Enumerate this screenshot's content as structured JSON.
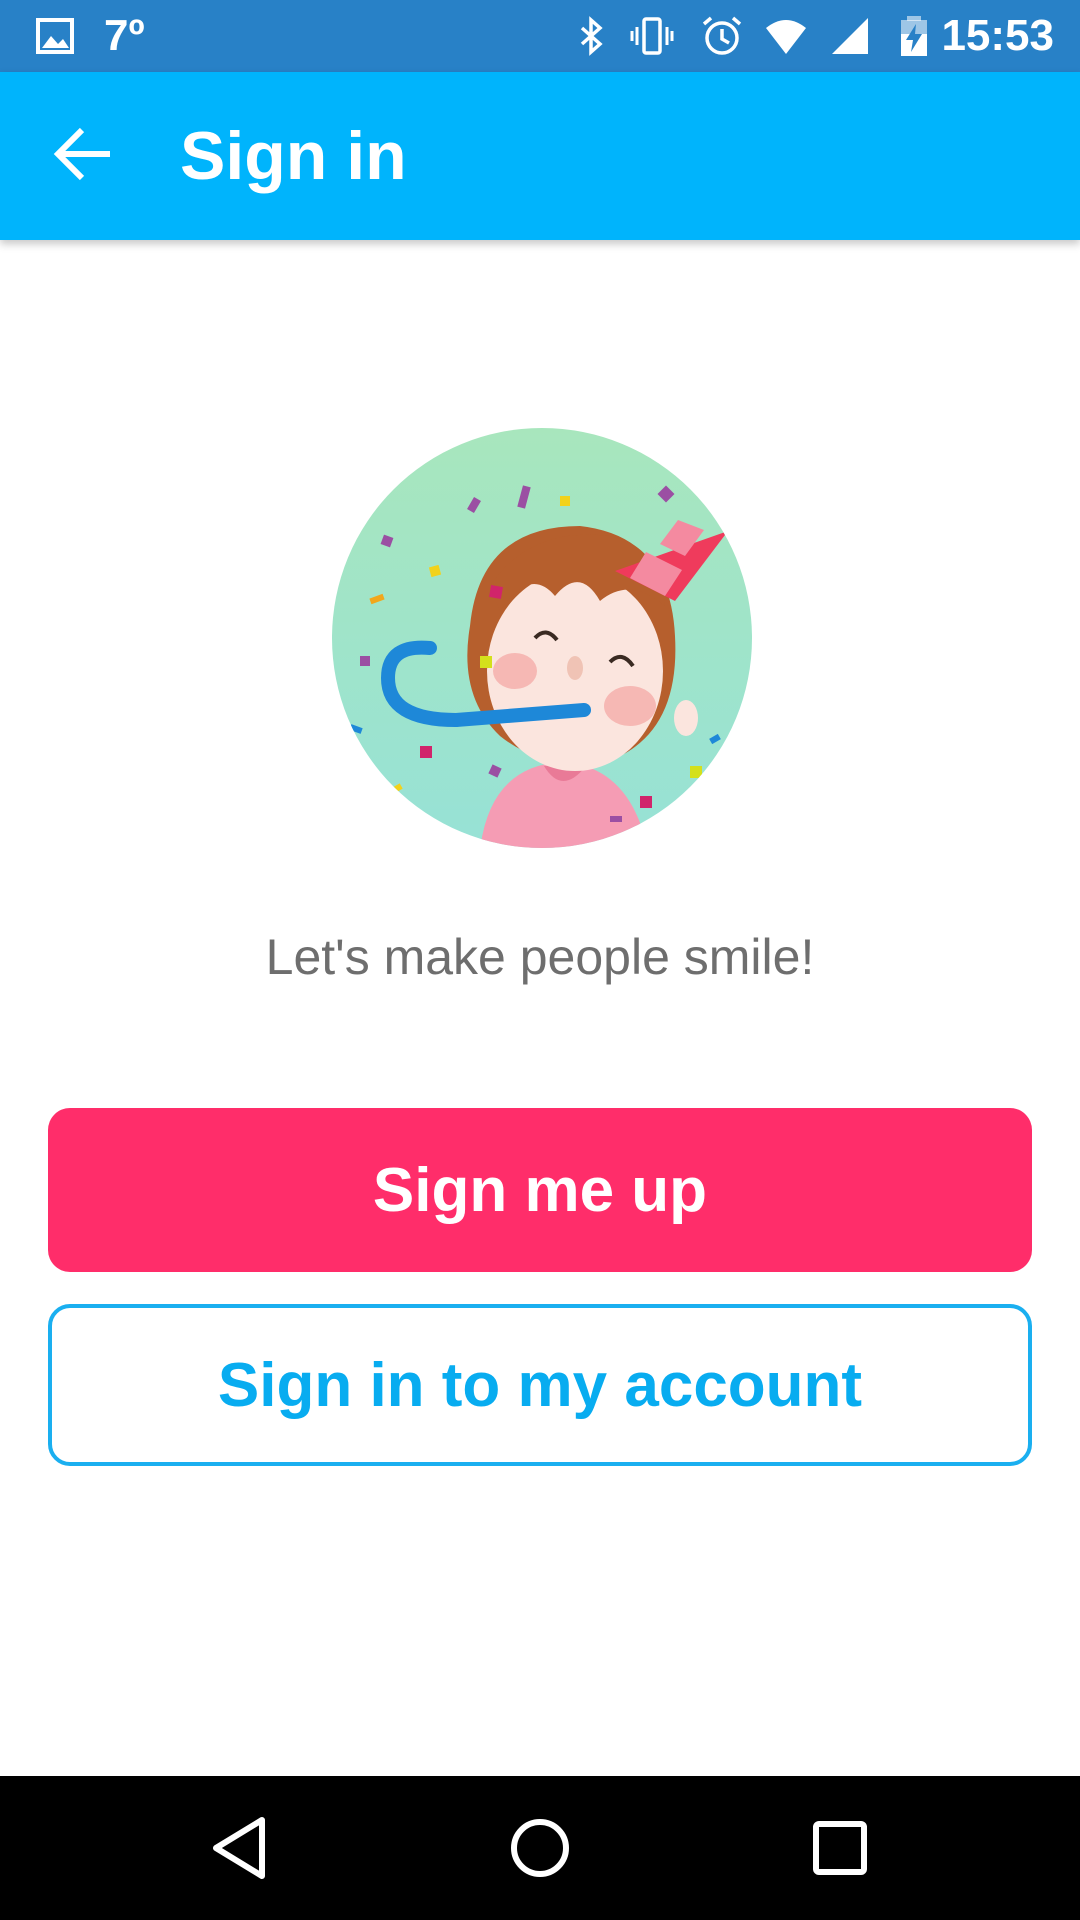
{
  "status_bar": {
    "temperature": "7º",
    "time": "15:53",
    "icons": [
      "image-icon",
      "bluetooth-icon",
      "vibrate-icon",
      "alarm-icon",
      "wifi-icon",
      "signal-icon",
      "battery-charging-icon"
    ]
  },
  "app_bar": {
    "back_icon": "arrow-back-icon",
    "title": "Sign in"
  },
  "main": {
    "hero_icon": "party-girl-illustration",
    "tagline": "Let's make people smile!",
    "primary_button": "Sign me up",
    "secondary_button": "Sign in to my account"
  },
  "nav_bar": {
    "icons": [
      "nav-back-icon",
      "nav-home-icon",
      "nav-recents-icon"
    ]
  },
  "colors": {
    "status_bar": "#2881c7",
    "app_bar": "#00b4fc",
    "primary": "#ff2d6a",
    "secondary": "#08acf0",
    "tagline": "#6e6e6e"
  }
}
